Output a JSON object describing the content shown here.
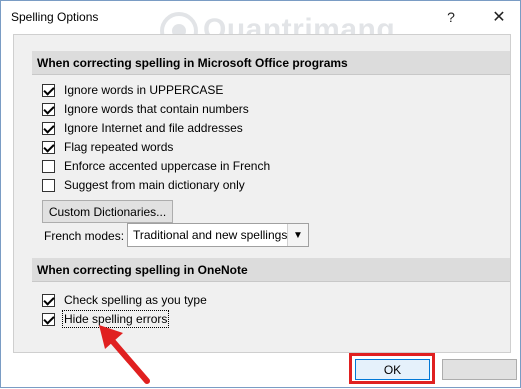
{
  "window": {
    "title": "Spelling Options",
    "help_glyph": "?",
    "close_glyph": "✕"
  },
  "watermark": {
    "text": "Quantrimang"
  },
  "office_section": {
    "header": "When correcting spelling in Microsoft Office programs",
    "options": [
      {
        "label": "Ignore words in UPPERCASE",
        "checked": true
      },
      {
        "label": "Ignore words that contain numbers",
        "checked": true
      },
      {
        "label": "Ignore Internet and file addresses",
        "checked": true
      },
      {
        "label": "Flag repeated words",
        "checked": true
      },
      {
        "label": "Enforce accented uppercase in French",
        "checked": false
      },
      {
        "label": "Suggest from main dictionary only",
        "checked": false
      }
    ],
    "custom_dictionaries_label": "Custom Dictionaries...",
    "french_modes_label": "French modes:",
    "french_modes_value": "Traditional and new spellings"
  },
  "onenote_section": {
    "header": "When correcting spelling in OneNote",
    "options": [
      {
        "label": "Check spelling as you type",
        "checked": true
      },
      {
        "label": "Hide spelling errors",
        "checked": true
      }
    ]
  },
  "footer": {
    "ok_label": "OK",
    "cancel_label": ""
  },
  "colors": {
    "highlight": "#e02020",
    "accent": "#0078d7"
  }
}
